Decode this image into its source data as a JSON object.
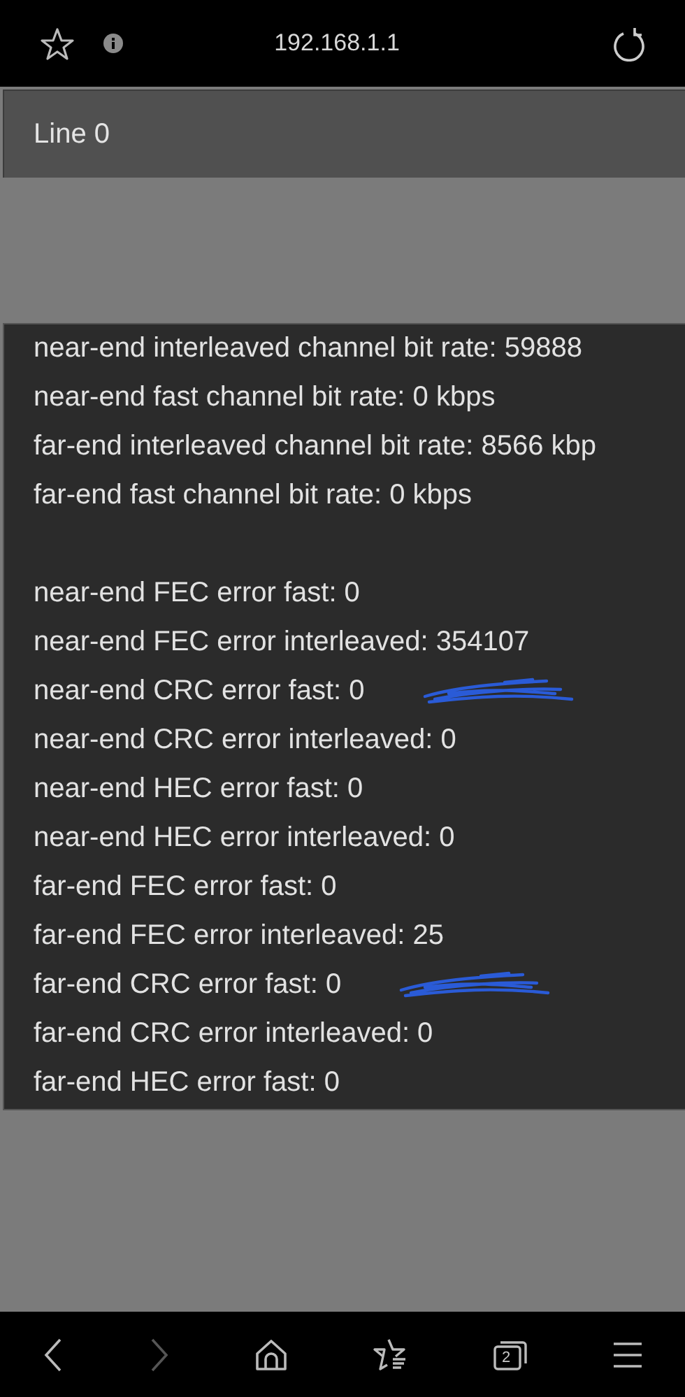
{
  "address_bar": {
    "url": "192.168.1.1"
  },
  "header": {
    "title": "Line 0"
  },
  "sections": [
    {
      "lines": [
        {
          "text": "near-end interleaved channel bit rate: 59888",
          "scribbled": false
        },
        {
          "text": "near-end fast channel bit rate: 0 kbps",
          "scribbled": false
        },
        {
          "text": "far-end interleaved channel bit rate: 8566 kbp",
          "scribbled": false
        },
        {
          "text": "far-end fast channel bit rate: 0 kbps",
          "scribbled": false
        }
      ]
    },
    {
      "lines": [
        {
          "text": "near-end FEC error fast: 0",
          "scribbled": false
        },
        {
          "text": "near-end FEC error interleaved: 354107",
          "scribbled": false
        },
        {
          "text": "near-end CRC error fast: 0",
          "scribbled": true
        },
        {
          "text": "near-end CRC error interleaved: 0",
          "scribbled": false
        },
        {
          "text": "near-end HEC error fast: 0",
          "scribbled": false
        },
        {
          "text": "near-end HEC error interleaved: 0",
          "scribbled": false
        },
        {
          "text": "far-end FEC error fast: 0",
          "scribbled": false
        },
        {
          "text": "far-end FEC error interleaved: 25",
          "scribbled": false
        },
        {
          "text": "far-end CRC error fast: 0",
          "scribbled": true
        },
        {
          "text": "far-end CRC error interleaved: 0",
          "scribbled": false
        },
        {
          "text": "far-end HEC error fast: 0",
          "scribbled": false
        }
      ]
    }
  ],
  "nav": {
    "back_disabled": false,
    "forward_disabled": true,
    "tab_count": "2"
  }
}
